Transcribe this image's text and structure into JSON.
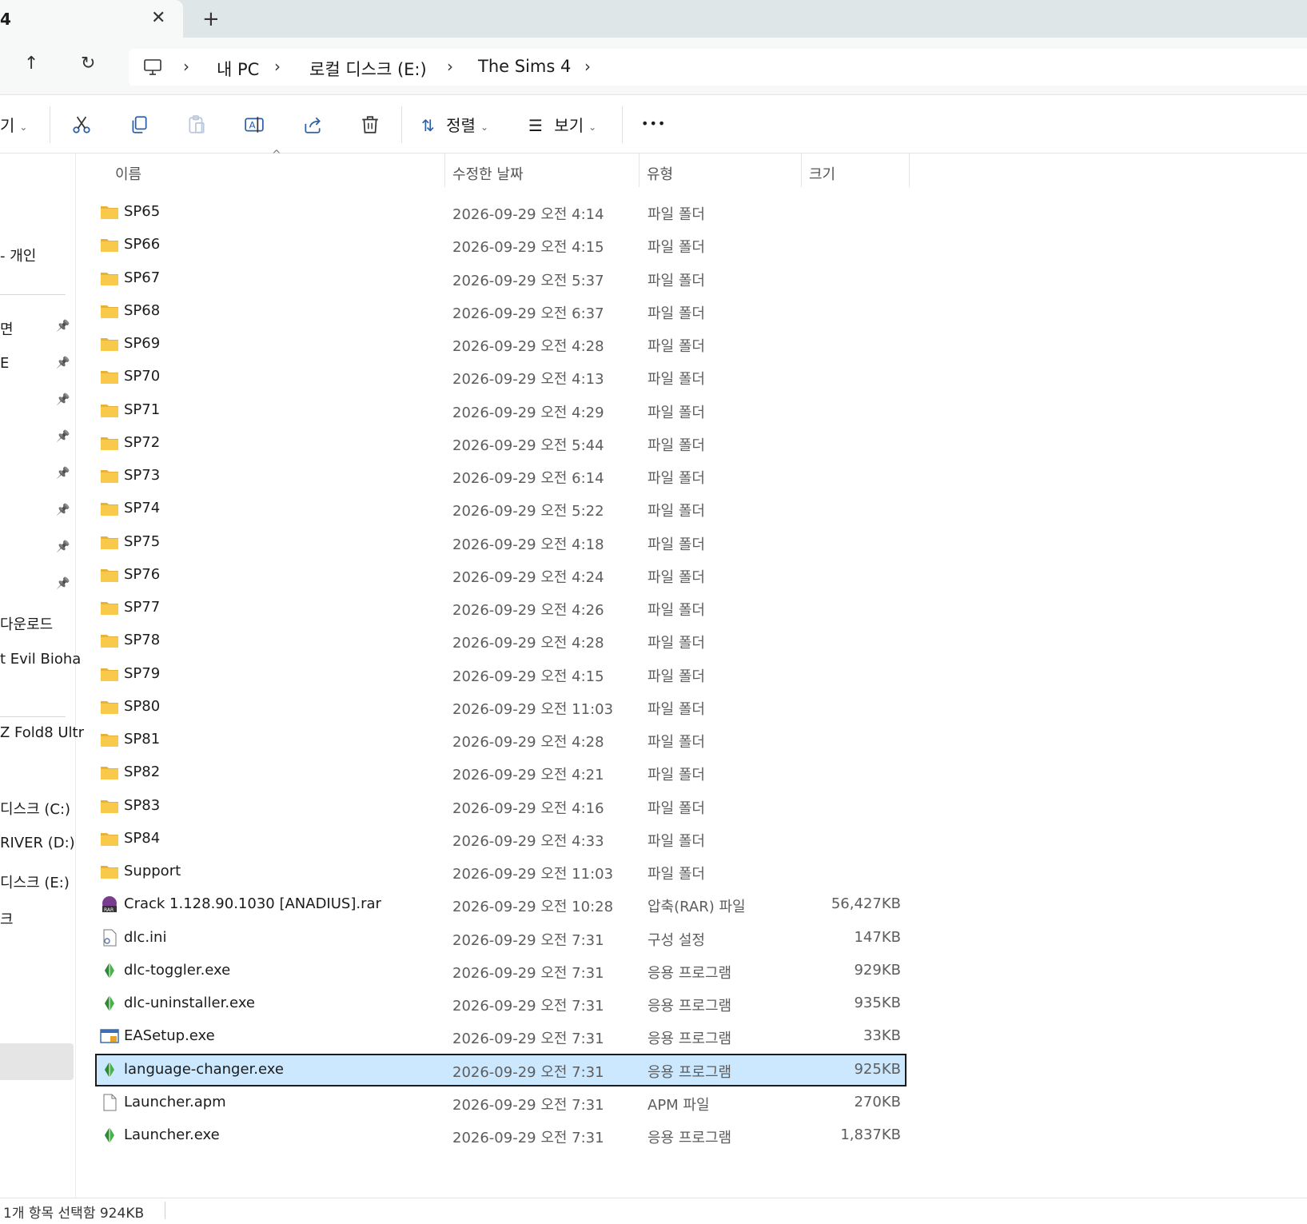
{
  "tab": {
    "title": "4",
    "close_glyph": "✕",
    "new_glyph": "+"
  },
  "nav": {
    "up_glyph": "↑",
    "refresh_glyph": "↻"
  },
  "breadcrumb": [
    "내 PC",
    "로컬 디스크 (E:)",
    "The Sims 4"
  ],
  "toolbar": {
    "new_label_partial": "기",
    "sort_label": "정렬",
    "view_label": "보기",
    "more_label": "•••"
  },
  "columns": {
    "name": "이름",
    "date": "수정한 날짜",
    "type": "유형",
    "size": "크기"
  },
  "sidebar": {
    "items": [
      {
        "label": "- 개인",
        "pin": false
      },
      {
        "label": "면",
        "pin": true
      },
      {
        "label": "E",
        "pin": true
      },
      {
        "label": "",
        "pin": true
      },
      {
        "label": "",
        "pin": true
      },
      {
        "label": "",
        "pin": true
      },
      {
        "label": "",
        "pin": true
      },
      {
        "label": "",
        "pin": true
      },
      {
        "label": "",
        "pin": true
      },
      {
        "label": "다운로드",
        "pin": false
      },
      {
        "label": "t Evil Bioha",
        "pin": false
      },
      {
        "label": "Z Fold8 Ultr",
        "pin": false
      },
      {
        "label": "디스크 (C:)",
        "pin": false
      },
      {
        "label": "RIVER (D:)",
        "pin": false
      },
      {
        "label": "디스크 (E:)",
        "pin": false
      },
      {
        "label": "크",
        "pin": false
      }
    ]
  },
  "files": [
    {
      "name": "SP65",
      "date": "2026-09-29 오전 4:14",
      "type": "파일 폴더",
      "size": "",
      "icon": "folder-icon"
    },
    {
      "name": "SP66",
      "date": "2026-09-29 오전 4:15",
      "type": "파일 폴더",
      "size": "",
      "icon": "folder-icon"
    },
    {
      "name": "SP67",
      "date": "2026-09-29 오전 5:37",
      "type": "파일 폴더",
      "size": "",
      "icon": "folder-icon"
    },
    {
      "name": "SP68",
      "date": "2026-09-29 오전 6:37",
      "type": "파일 폴더",
      "size": "",
      "icon": "folder-icon"
    },
    {
      "name": "SP69",
      "date": "2026-09-29 오전 4:28",
      "type": "파일 폴더",
      "size": "",
      "icon": "folder-icon"
    },
    {
      "name": "SP70",
      "date": "2026-09-29 오전 4:13",
      "type": "파일 폴더",
      "size": "",
      "icon": "folder-icon"
    },
    {
      "name": "SP71",
      "date": "2026-09-29 오전 4:29",
      "type": "파일 폴더",
      "size": "",
      "icon": "folder-icon"
    },
    {
      "name": "SP72",
      "date": "2026-09-29 오전 5:44",
      "type": "파일 폴더",
      "size": "",
      "icon": "folder-icon"
    },
    {
      "name": "SP73",
      "date": "2026-09-29 오전 6:14",
      "type": "파일 폴더",
      "size": "",
      "icon": "folder-icon"
    },
    {
      "name": "SP74",
      "date": "2026-09-29 오전 5:22",
      "type": "파일 폴더",
      "size": "",
      "icon": "folder-icon"
    },
    {
      "name": "SP75",
      "date": "2026-09-29 오전 4:18",
      "type": "파일 폴더",
      "size": "",
      "icon": "folder-icon"
    },
    {
      "name": "SP76",
      "date": "2026-09-29 오전 4:24",
      "type": "파일 폴더",
      "size": "",
      "icon": "folder-icon"
    },
    {
      "name": "SP77",
      "date": "2026-09-29 오전 4:26",
      "type": "파일 폴더",
      "size": "",
      "icon": "folder-icon"
    },
    {
      "name": "SP78",
      "date": "2026-09-29 오전 4:28",
      "type": "파일 폴더",
      "size": "",
      "icon": "folder-icon"
    },
    {
      "name": "SP79",
      "date": "2026-09-29 오전 4:15",
      "type": "파일 폴더",
      "size": "",
      "icon": "folder-icon"
    },
    {
      "name": "SP80",
      "date": "2026-09-29 오전 11:03",
      "type": "파일 폴더",
      "size": "",
      "icon": "folder-icon"
    },
    {
      "name": "SP81",
      "date": "2026-09-29 오전 4:28",
      "type": "파일 폴더",
      "size": "",
      "icon": "folder-icon"
    },
    {
      "name": "SP82",
      "date": "2026-09-29 오전 4:21",
      "type": "파일 폴더",
      "size": "",
      "icon": "folder-icon"
    },
    {
      "name": "SP83",
      "date": "2026-09-29 오전 4:16",
      "type": "파일 폴더",
      "size": "",
      "icon": "folder-icon"
    },
    {
      "name": "SP84",
      "date": "2026-09-29 오전 4:33",
      "type": "파일 폴더",
      "size": "",
      "icon": "folder-icon"
    },
    {
      "name": "Support",
      "date": "2026-09-29 오전 11:03",
      "type": "파일 폴더",
      "size": "",
      "icon": "folder-icon"
    },
    {
      "name": "Crack 1.128.90.1030 [ANADIUS].rar",
      "date": "2026-09-29 오전 10:28",
      "type": "압축(RAR) 파일",
      "size": "56,427KB",
      "icon": "rar-icon"
    },
    {
      "name": "dlc.ini",
      "date": "2026-09-29 오전 7:31",
      "type": "구성 설정",
      "size": "147KB",
      "icon": "ini-file-icon"
    },
    {
      "name": "dlc-toggler.exe",
      "date": "2026-09-29 오전 7:31",
      "type": "응용 프로그램",
      "size": "929KB",
      "icon": "plumbob-icon"
    },
    {
      "name": "dlc-uninstaller.exe",
      "date": "2026-09-29 오전 7:31",
      "type": "응용 프로그램",
      "size": "935KB",
      "icon": "plumbob-icon"
    },
    {
      "name": "EASetup.exe",
      "date": "2026-09-29 오전 7:31",
      "type": "응용 프로그램",
      "size": "33KB",
      "icon": "setup-icon"
    },
    {
      "name": "language-changer.exe",
      "date": "2026-09-29 오전 7:31",
      "type": "응용 프로그램",
      "size": "925KB",
      "icon": "plumbob-icon",
      "selected": true
    },
    {
      "name": "Launcher.apm",
      "date": "2026-09-29 오전 7:31",
      "type": "APM 파일",
      "size": "270KB",
      "icon": "blank-file-icon"
    },
    {
      "name": "Launcher.exe",
      "date": "2026-09-29 오전 7:31",
      "type": "응용 프로그램",
      "size": "1,837KB",
      "icon": "plumbob-icon"
    }
  ],
  "status": {
    "text": "1개 항목 선택함 924KB"
  },
  "colors": {
    "selection": "#cce8ff",
    "folder": "#f8c94a",
    "tabbar": "#dfe6e8"
  }
}
